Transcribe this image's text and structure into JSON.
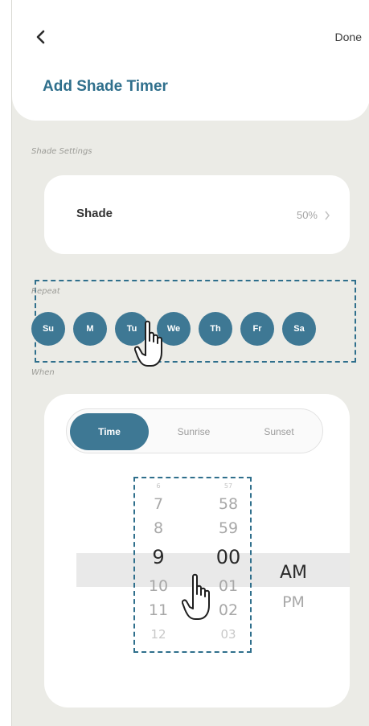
{
  "header": {
    "done_label": "Done",
    "title": "Add Shade Timer"
  },
  "shade_settings": {
    "section_label": "Shade Settings",
    "label": "Shade",
    "value": "50%"
  },
  "repeat": {
    "section_label": "Repeat",
    "days": [
      "Su",
      "M",
      "Tu",
      "We",
      "Th",
      "Fr",
      "Sa"
    ]
  },
  "when": {
    "section_label": "When",
    "tabs": [
      "Time",
      "Sunrise",
      "Sunset"
    ],
    "active_tab": "Time",
    "picker": {
      "hours_above": [
        "6",
        "7",
        "8"
      ],
      "hour_selected": "9",
      "hours_below": [
        "10",
        "11",
        "12"
      ],
      "minutes_above": [
        "57",
        "58",
        "59"
      ],
      "minute_selected": "00",
      "minutes_below": [
        "01",
        "02",
        "03"
      ],
      "period_selected": "AM",
      "period_other": "PM"
    }
  },
  "colors": {
    "accent": "#3e7894",
    "title": "#2f6f8c",
    "background": "#ebebe6"
  }
}
